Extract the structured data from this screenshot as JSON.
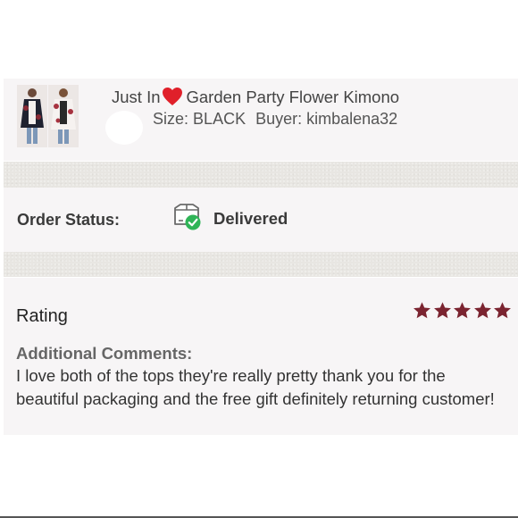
{
  "listing": {
    "badge_text": "Just In",
    "title": "Garden Party Flower Kimono",
    "size_label": "Size:",
    "size_value": "BLACK",
    "buyer_label": "Buyer:",
    "buyer_value": "kimbalena32",
    "badge_icon": "heart-icon"
  },
  "order": {
    "status_label": "Order Status:",
    "status_value": "Delivered",
    "status_icon": "package-delivered-icon"
  },
  "rating": {
    "label": "Rating",
    "stars": 5,
    "max_stars": 5,
    "star_color": "#7b2430",
    "comments_heading": "Additional Comments:",
    "comments_text": "I love both of the tops they're really pretty thank you for the beautiful packaging and the free gift definitely returning customer!"
  },
  "colors": {
    "card_bg": "#f7f5f6",
    "divider_band": "#e8e6e2",
    "check_green": "#2fb457",
    "heart_red": "#e0202a"
  }
}
